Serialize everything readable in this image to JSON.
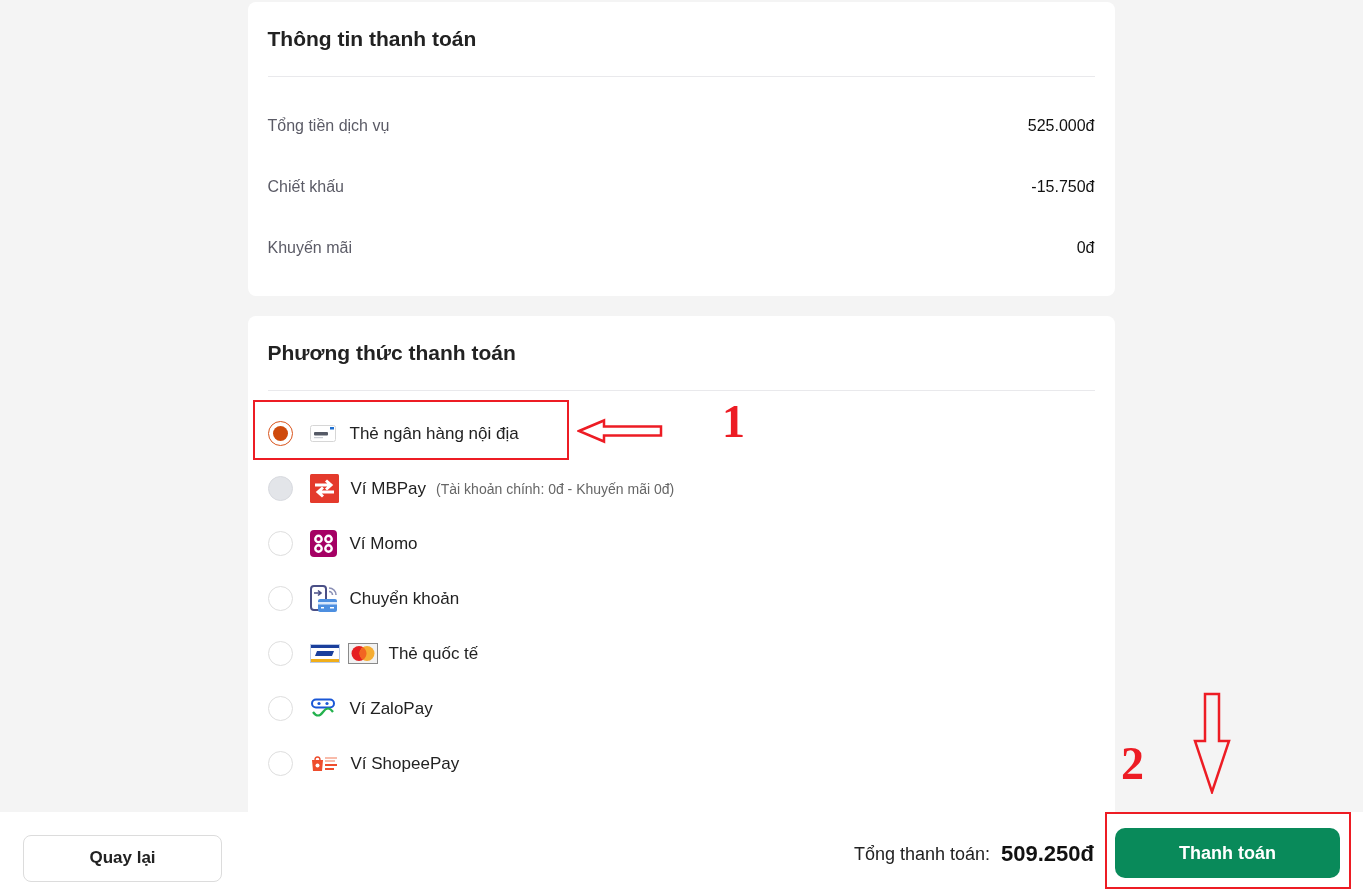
{
  "payment_info": {
    "title": "Thông tin thanh toán",
    "rows": [
      {
        "label": "Tổng tiền dịch vụ",
        "value": "525.000đ"
      },
      {
        "label": "Chiết khấu",
        "value": "-15.750đ"
      },
      {
        "label": "Khuyến mãi",
        "value": "0đ"
      }
    ]
  },
  "payment_methods": {
    "title": "Phương thức thanh toán",
    "options": [
      {
        "label": "Thẻ ngân hàng nội địa",
        "selected": true,
        "disabled": false
      },
      {
        "label": "Ví MBPay",
        "note": "(Tài khoản chính: 0đ - Khuyến mãi 0đ)",
        "selected": false,
        "disabled": true
      },
      {
        "label": "Ví Momo",
        "selected": false,
        "disabled": false
      },
      {
        "label": "Chuyển khoản",
        "selected": false,
        "disabled": false
      },
      {
        "label": "Thẻ quốc tế",
        "selected": false,
        "disabled": false
      },
      {
        "label": "Ví ZaloPay",
        "selected": false,
        "disabled": false
      },
      {
        "label": "Ví ShopeePay",
        "selected": false,
        "disabled": false
      }
    ]
  },
  "footer": {
    "back_button": "Quay lại",
    "total_label": "Tổng thanh toán:",
    "total_value": "509.250đ",
    "pay_button": "Thanh toán"
  },
  "annotations": [
    {
      "number": "1"
    },
    {
      "number": "2"
    }
  ]
}
